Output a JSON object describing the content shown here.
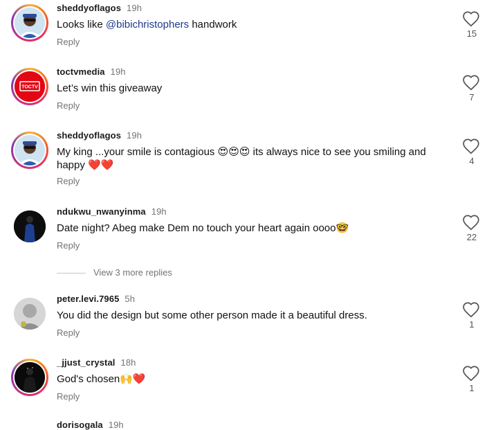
{
  "comments": [
    {
      "username": "sheddyoflagos",
      "time": "19h",
      "text_before": "Looks like ",
      "mention": "@bibichristophers",
      "text_after": " handwork",
      "reply_label": "Reply",
      "likes": "15"
    },
    {
      "username": "toctvmedia",
      "time": "19h",
      "text": "Let’s win this giveaway",
      "reply_label": "Reply",
      "likes": "7",
      "avatar_logo_text": "TOCTV"
    },
    {
      "username": "sheddyoflagos",
      "time": "19h",
      "text_line1": "My king ...your smile is contagious 😍😍😍 its always nice to see you smiling and",
      "text_line2": "happy ❤️❤️",
      "reply_label": "Reply",
      "likes": "4"
    },
    {
      "username": "ndukwu_nwanyinma",
      "time": "19h",
      "text": "Date night? Abeg make Dem no touch your heart again oooo🤓",
      "reply_label": "Reply",
      "likes": "22"
    },
    {
      "username": "peter.levi.7965",
      "time": "5h",
      "text": "You did the design but some other person made it a beautiful dress.",
      "reply_label": "Reply",
      "likes": "1"
    },
    {
      "username": "_jjust_crystal",
      "time": "18h",
      "text": "God's chosen🙌❤️",
      "reply_label": "Reply",
      "likes": "1"
    },
    {
      "username": "dorisogala",
      "time": "19h"
    }
  ],
  "view_more_replies": "View 3 more replies",
  "colors": {
    "story_ring": "#e1306c",
    "mention": "#1f3a8a",
    "secondary_text": "#737373",
    "toctv_red": "#e30613"
  }
}
